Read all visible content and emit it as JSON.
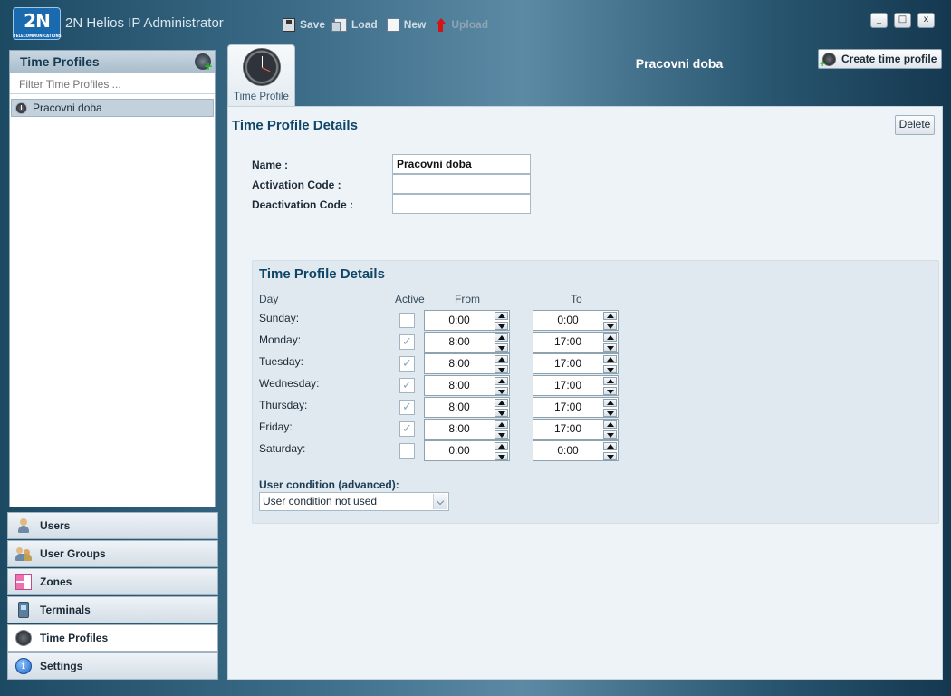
{
  "app": {
    "logo_text": "2N",
    "logo_sub": "TELECOMMUNICATIONS",
    "title": "2N Helios IP Administrator"
  },
  "toolbar": {
    "save": "Save",
    "load": "Load",
    "new": "New",
    "upload": "Upload"
  },
  "window_controls": {
    "minimize": "_",
    "maximize": "□",
    "close": "x"
  },
  "left_panel": {
    "title": "Time Profiles",
    "filter_placeholder": "Filter Time Profiles ...",
    "items": [
      {
        "label": "Pracovni doba"
      }
    ]
  },
  "nav": {
    "users": "Users",
    "user_groups": "User Groups",
    "zones": "Zones",
    "terminals": "Terminals",
    "time_profiles": "Time Profiles",
    "settings": "Settings",
    "settings_icon_glyph": "i",
    "active": "Time Profiles"
  },
  "main": {
    "tab_label": "Time Profile",
    "header_title": "Pracovni doba",
    "create_button": "Create time profile",
    "details_title": "Time Profile Details",
    "delete_button": "Delete",
    "fields": {
      "name_label": "Name :",
      "name_value": "Pracovni doba",
      "activation_label": "Activation Code :",
      "activation_value": "",
      "deactivation_label": "Deactivation Code :",
      "deactivation_value": ""
    },
    "schedule": {
      "title": "Time Profile Details",
      "columns": {
        "day": "Day",
        "active": "Active",
        "from": "From",
        "to": "To"
      },
      "check_glyph": "✓",
      "rows": [
        {
          "day": "Sunday:",
          "active": false,
          "from": "0:00",
          "to": "0:00"
        },
        {
          "day": "Monday:",
          "active": true,
          "from": "8:00",
          "to": "17:00"
        },
        {
          "day": "Tuesday:",
          "active": true,
          "from": "8:00",
          "to": "17:00"
        },
        {
          "day": "Wednesday:",
          "active": true,
          "from": "8:00",
          "to": "17:00"
        },
        {
          "day": "Thursday:",
          "active": true,
          "from": "8:00",
          "to": "17:00"
        },
        {
          "day": "Friday:",
          "active": true,
          "from": "8:00",
          "to": "17:00"
        },
        {
          "day": "Saturday:",
          "active": false,
          "from": "0:00",
          "to": "0:00"
        }
      ],
      "user_condition_label": "User condition (advanced):",
      "user_condition_value": "User condition not used"
    }
  }
}
